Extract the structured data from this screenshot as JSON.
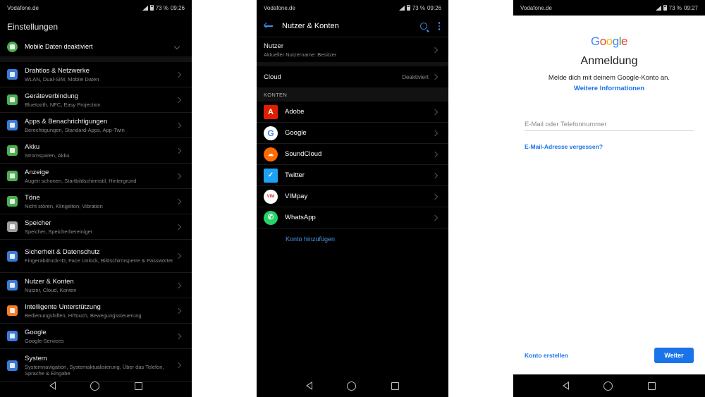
{
  "status": {
    "p1": {
      "carrier": "Vodafone.de",
      "battery": "73 %",
      "time": "09:26"
    },
    "p2": {
      "carrier": "Vodafone.de",
      "battery": "73 %",
      "time": "09:26"
    },
    "p3": {
      "carrier": "Vodafone.de",
      "battery": "73 %",
      "time": "09:27"
    }
  },
  "settings": {
    "title": "Einstellungen",
    "mobile_data": "Mobile Daten deaktiviert",
    "items": [
      {
        "title": "Drahtlos & Netzwerke",
        "sub": "WLAN, Dual-SIM, Mobile Daten",
        "icon": "wifi-icon",
        "color": "#3a7bd5"
      },
      {
        "title": "Geräteverbindung",
        "sub": "Bluetooth, NFC, Easy Projection",
        "icon": "device-connection-icon",
        "color": "#4caf50"
      },
      {
        "title": "Apps & Benachrichtigungen",
        "sub": "Berechtigungen, Standard-Apps, App-Twin",
        "icon": "apps-icon",
        "color": "#3a7bd5"
      },
      {
        "title": "Akku",
        "sub": "Stromsparen, Akku",
        "icon": "battery-icon",
        "color": "#4caf50"
      },
      {
        "title": "Anzeige",
        "sub": "Augen schonen, Startbildschirmstil, Hintergrund",
        "icon": "display-icon",
        "color": "#4caf50"
      },
      {
        "title": "Töne",
        "sub": "Nicht stören, Klingelton, Vibration",
        "icon": "sound-icon",
        "color": "#4caf50"
      },
      {
        "title": "Speicher",
        "sub": "Speicher, Speicherbereiniger",
        "icon": "storage-icon",
        "color": "#9e9e9e"
      },
      {
        "title": "Sicherheit & Datenschutz",
        "sub": "Fingerabdruck-ID, Face Unlock, Bildschirmsperre & Passwörter",
        "icon": "security-icon",
        "color": "#3a7bd5"
      },
      {
        "title": "Nutzer & Konten",
        "sub": "Nutzer, Cloud, Konten",
        "icon": "users-icon",
        "color": "#3a7bd5"
      },
      {
        "title": "Intelligente Unterstützung",
        "sub": "Bedienungshilfen, HiTouch, Bewegungssteuerung",
        "icon": "assist-icon",
        "color": "#f57c2b"
      },
      {
        "title": "Google",
        "sub": "Google-Services",
        "icon": "google-icon",
        "color": "#3a7bd5"
      },
      {
        "title": "System",
        "sub": "Systemnavigation, Systemaktualisierung, Über das Telefon, Sprache & Eingabe",
        "icon": "system-icon",
        "color": "#3a7bd5"
      }
    ]
  },
  "accounts": {
    "title": "Nutzer & Konten",
    "user_title": "Nutzer",
    "user_sub": "Aktueller Nutzername: Besitzer",
    "cloud_title": "Cloud",
    "cloud_value": "Deaktiviert",
    "section": "KONTEN",
    "list": [
      {
        "name": "Adobe",
        "icon": "adobe-icon",
        "color": "#e01e00"
      },
      {
        "name": "Google",
        "icon": "google-icon",
        "color": "#ffffff"
      },
      {
        "name": "SoundCloud",
        "icon": "soundcloud-icon",
        "color": "#ff6a00"
      },
      {
        "name": "Twitter",
        "icon": "twitter-icon",
        "color": "#1da1f2"
      },
      {
        "name": "VIMpay",
        "icon": "vimpay-icon",
        "color": "#ffffff"
      },
      {
        "name": "WhatsApp",
        "icon": "whatsapp-icon",
        "color": "#25d366"
      }
    ],
    "add": "Konto hinzufügen"
  },
  "signin": {
    "logo": "Google",
    "title": "Anmeldung",
    "subtitle": "Melde dich mit deinem Google-Konto an.",
    "more": "Weitere Informationen",
    "email_placeholder": "E-Mail oder Telefonnummer",
    "forgot": "E-Mail-Adresse vergessen?",
    "create": "Konto erstellen",
    "next": "Weiter"
  }
}
